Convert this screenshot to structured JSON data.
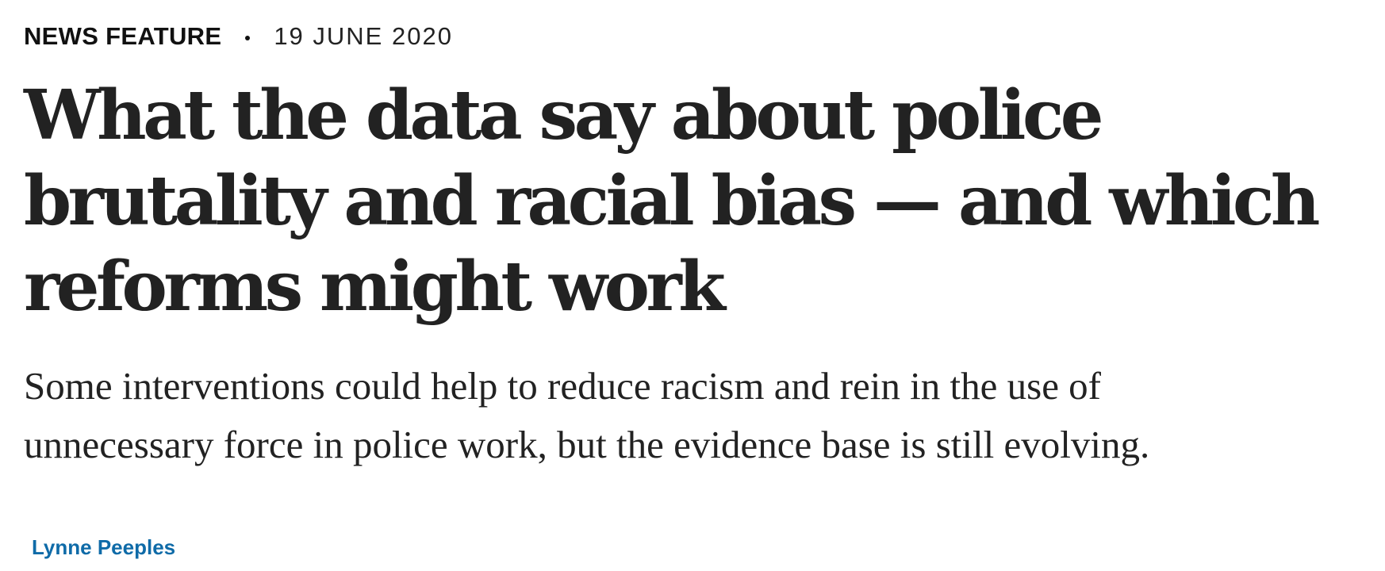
{
  "article": {
    "type": "NEWS FEATURE",
    "date": "19 JUNE 2020",
    "title": "What the data say about police brutality and racial bias — and which reforms might work",
    "standfirst": "Some interventions could help to reduce racism and rein in the use of unnecessary force in police work, but the evidence base is still evolving.",
    "author": "Lynne Peeples"
  },
  "colors": {
    "text": "#222222",
    "author_link": "#0f6ba8",
    "background": "#ffffff"
  }
}
